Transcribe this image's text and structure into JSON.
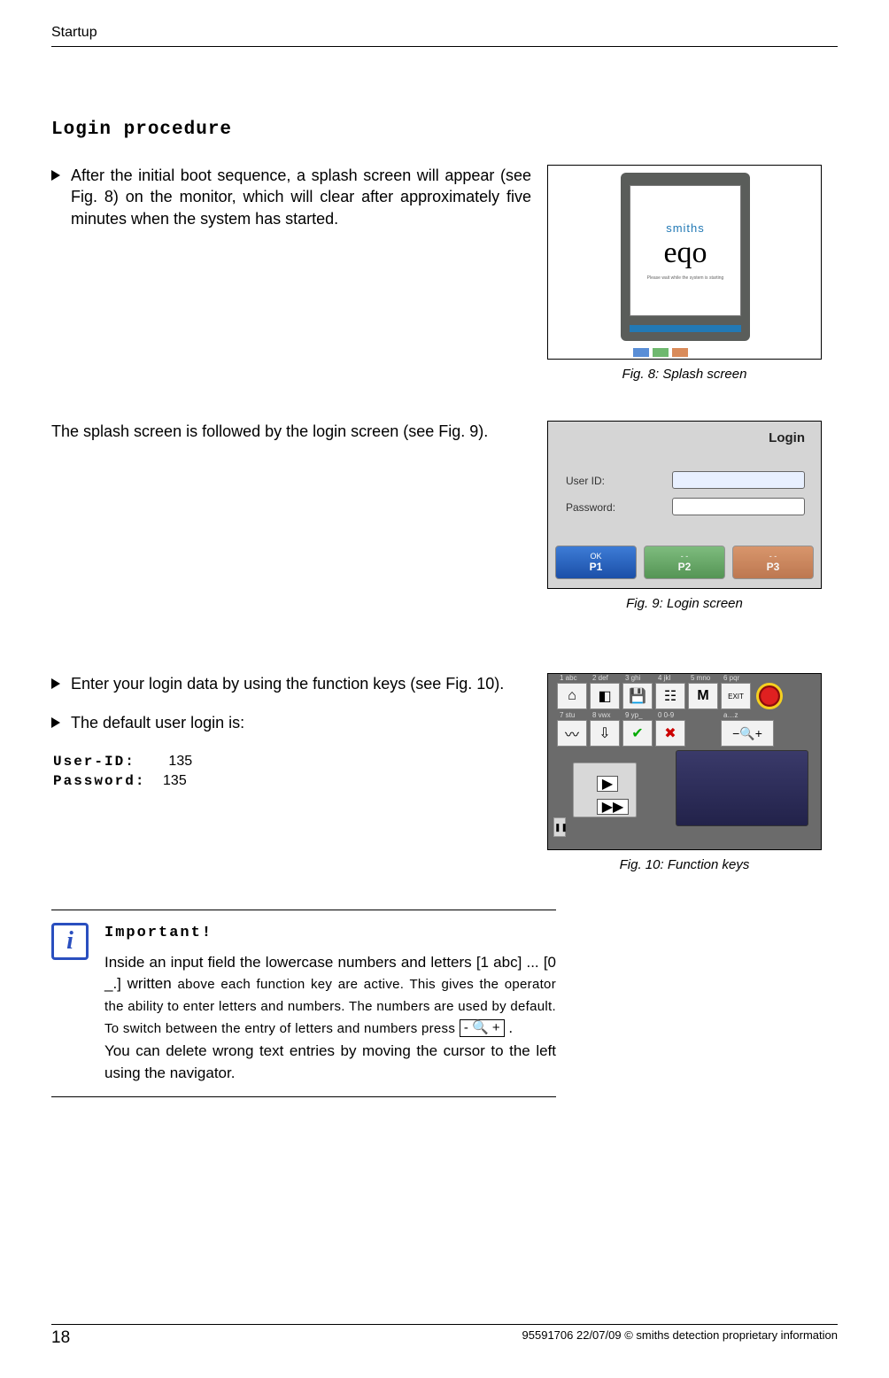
{
  "header": {
    "title": "Startup"
  },
  "section": {
    "title": "Login procedure"
  },
  "para1": "After the initial boot sequence, a splash screen will appear (see Fig. 8) on the monitor, which will clear after approximately five minutes when the system has started.",
  "fig8": {
    "caption": "Fig. 8: Splash screen",
    "brand": "smiths",
    "product": "eqo",
    "hint": "Please wait while the system is starting"
  },
  "para2": "The splash screen is followed by the login screen (see Fig. 9).",
  "fig9": {
    "caption": "Fig. 9: Login screen",
    "title": "Login",
    "user_label": "User ID:",
    "pass_label": "Password:",
    "buttons": {
      "p1": {
        "small": "OK",
        "big": "P1"
      },
      "p2": {
        "small": "- -",
        "big": "P2"
      },
      "p3": {
        "small": "- -",
        "big": "P3"
      }
    }
  },
  "para3": "Enter your login data by using the function keys (see Fig. 10).",
  "para4": "The default user login is:",
  "credentials": {
    "user_label": "User-ID:",
    "user_value": "135",
    "pass_label": "Password:",
    "pass_value": "135"
  },
  "fig10": {
    "caption": "Fig. 10: Function keys",
    "keylabels": [
      "1  abc",
      "2  def",
      "3  ghi",
      "4  jkl",
      "5 mno",
      "6  pqr"
    ],
    "keylabels2": [
      "7  stu",
      "8  vwx",
      "9  yp_",
      "0   0-9",
      "a…z"
    ],
    "icons": {
      "exit": "EXIT",
      "m": "M",
      "save": "💾",
      "bell": "⌂",
      "down": "⇩",
      "check": "✔",
      "cross": "✖",
      "zoom_minus": "−",
      "zoom_glass": "🔍",
      "zoom_plus": "+",
      "play": "▶",
      "ff": "▶▶",
      "pause": "❚❚"
    }
  },
  "important": {
    "title": "Important!",
    "line1a": "Inside an input field the lowercase numbers and letters [1 abc] ... [0 _.] written ",
    "line1b": "above each function key are active. This gives the operator the ability to enter letters and numbers. The numbers are used by default. To switch between the entry of letters and numbers press",
    "zoom_label": "- 🔍 +",
    "period": ".",
    "line2": "You can delete wrong text entries by moving the cursor to the left using the navigator."
  },
  "footer": {
    "page": "18",
    "right": "95591706 22/07/09 © smiths detection proprietary information"
  }
}
